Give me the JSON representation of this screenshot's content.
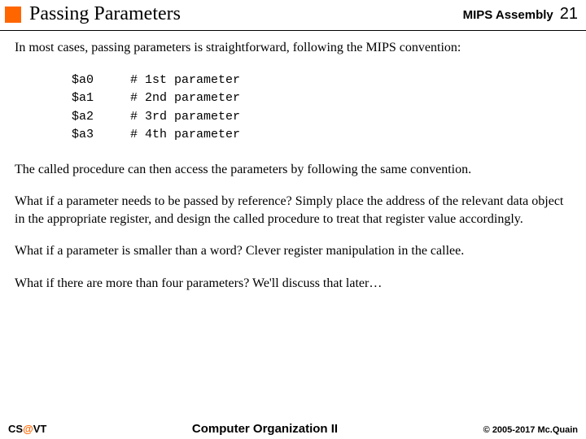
{
  "header": {
    "title": "Passing Parameters",
    "course": "MIPS Assembly",
    "slide_number": "21"
  },
  "body": {
    "intro": "In most cases, passing parameters is straightforward, following the MIPS convention:",
    "code": "$a0     # 1st parameter\n$a1     # 2nd parameter\n$a2     # 3rd parameter\n$a3     # 4th parameter",
    "p1": "The called procedure can then access the parameters by following the same convention.",
    "p2": "What if a parameter needs to be passed by reference?  Simply place the address of the relevant data object in the appropriate register, and design the called procedure to treat that register value accordingly.",
    "p3": "What if a parameter is smaller than a word?  Clever register manipulation in the callee.",
    "p4": "What if there are more than four parameters?  We'll discuss that later…"
  },
  "footer": {
    "left_prefix": "CS",
    "left_at": "@",
    "left_suffix": "VT",
    "center": "Computer Organization II",
    "right": "© 2005-2017 Mc.Quain"
  }
}
